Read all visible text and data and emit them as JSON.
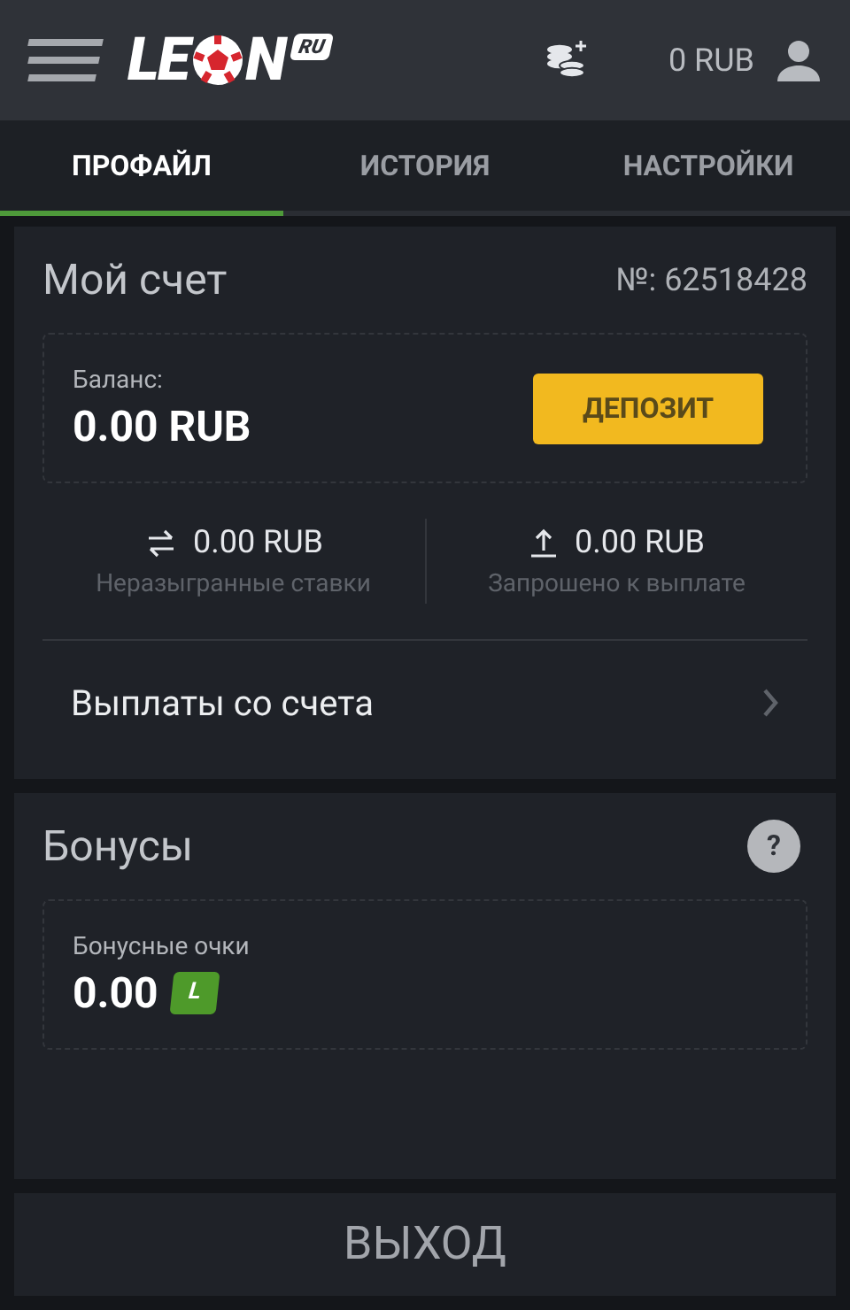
{
  "header": {
    "logo": {
      "text_start": "LE",
      "text_end": "N",
      "badge": "RU"
    },
    "balance": "0 RUB"
  },
  "tabs": [
    {
      "label": "ПРОФАЙЛ",
      "selected": true
    },
    {
      "label": "ИСТОРИЯ",
      "selected": false
    },
    {
      "label": "НАСТРОЙКИ",
      "selected": false
    }
  ],
  "account": {
    "title": "Мой счет",
    "number": "№: 62518428",
    "balance_label": "Баланс:",
    "balance": "0.00 RUB",
    "deposit_button": "ДЕПОЗИТ",
    "stats": [
      {
        "kind": "bets",
        "value": "0.00 RUB",
        "label": "Неразыгранные ставки"
      },
      {
        "kind": "withdrawal",
        "value": "0.00 RUB",
        "label": "Запрошено к выплате"
      }
    ],
    "link": "Выплаты со счета"
  },
  "bonuses": {
    "title": "Бонусы",
    "help": "?",
    "points_label": "Бонусные очки",
    "points": "0.00",
    "points_badge": "L"
  },
  "logout_button": "ВЫХОД"
}
